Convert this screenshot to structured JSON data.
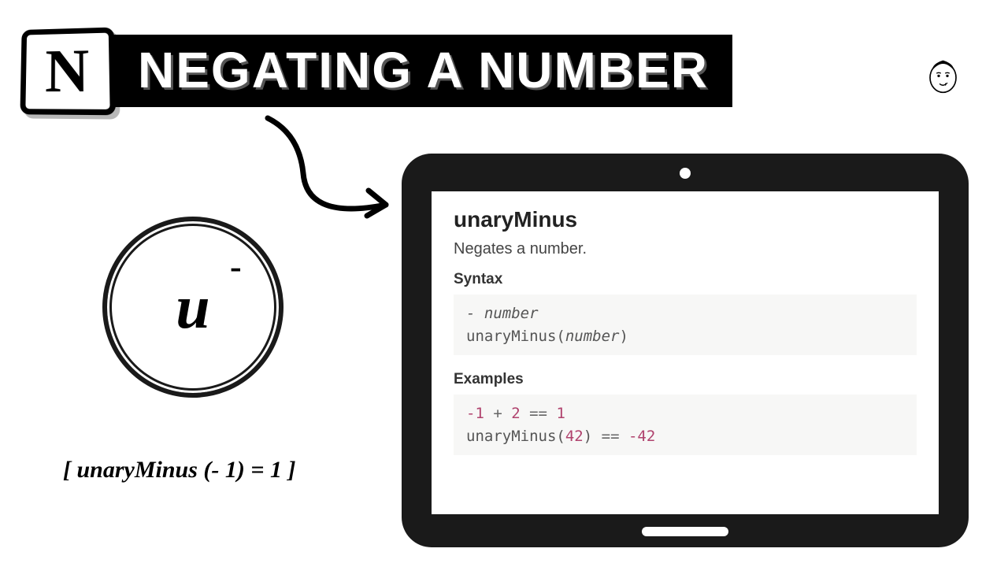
{
  "header": {
    "logo_letter": "N",
    "title": "NEGATING A NUMBER"
  },
  "badge": {
    "letter": "u",
    "sup": "-"
  },
  "formula": "[ unaryMinus (- 1) = 1 ]",
  "doc": {
    "name": "unaryMinus",
    "description": "Negates a number.",
    "syntax_heading": "Syntax",
    "syntax_line1_prefix": "- ",
    "syntax_line1_arg": "number",
    "syntax_line2a": "unaryMinus(",
    "syntax_line2_arg": "number",
    "syntax_line2b": ")",
    "examples_heading": "Examples",
    "ex1": {
      "a": "-1",
      "plus": " + ",
      "b": "2",
      "eq": " == ",
      "c": "1"
    },
    "ex2": {
      "fn": "unaryMinus(",
      "arg": "42",
      "close": ")",
      "eq": " == ",
      "res": "-42"
    }
  }
}
